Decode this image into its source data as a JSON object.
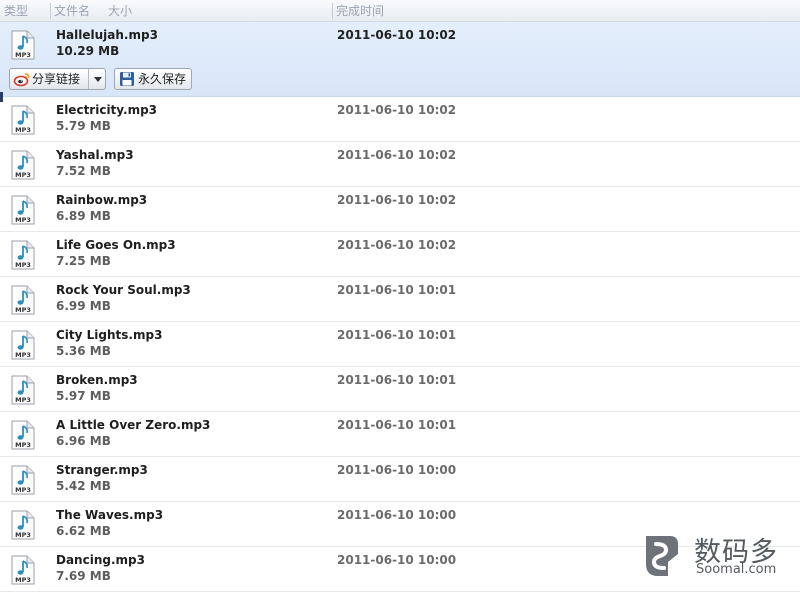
{
  "header": {
    "col_type": "类型",
    "col_name": "文件名",
    "col_size": "大小",
    "col_time": "完成时间"
  },
  "selected_actions": {
    "share_label": "分享链接",
    "save_label": "永久保存",
    "share_icon": "weibo-icon",
    "save_icon": "floppy-disk-icon"
  },
  "files": [
    {
      "name": "Hallelujah.mp3",
      "size": "10.29 MB",
      "time": "2011-06-10 10:02",
      "type_icon": "mp3-file-icon"
    },
    {
      "name": "Electricity.mp3",
      "size": "5.79 MB",
      "time": "2011-06-10 10:02",
      "type_icon": "mp3-file-icon"
    },
    {
      "name": "Yashal.mp3",
      "size": "7.52 MB",
      "time": "2011-06-10 10:02",
      "type_icon": "mp3-file-icon"
    },
    {
      "name": "Rainbow.mp3",
      "size": "6.89 MB",
      "time": "2011-06-10 10:02",
      "type_icon": "mp3-file-icon"
    },
    {
      "name": "Life Goes On.mp3",
      "size": "7.25 MB",
      "time": "2011-06-10 10:02",
      "type_icon": "mp3-file-icon"
    },
    {
      "name": "Rock Your Soul.mp3",
      "size": "6.99 MB",
      "time": "2011-06-10 10:01",
      "type_icon": "mp3-file-icon"
    },
    {
      "name": "City Lights.mp3",
      "size": "5.36 MB",
      "time": "2011-06-10 10:01",
      "type_icon": "mp3-file-icon"
    },
    {
      "name": "Broken.mp3",
      "size": "5.97 MB",
      "time": "2011-06-10 10:01",
      "type_icon": "mp3-file-icon"
    },
    {
      "name": "A Little Over Zero.mp3",
      "size": "6.96 MB",
      "time": "2011-06-10 10:01",
      "type_icon": "mp3-file-icon"
    },
    {
      "name": "Stranger.mp3",
      "size": "5.42 MB",
      "time": "2011-06-10 10:00",
      "type_icon": "mp3-file-icon"
    },
    {
      "name": "The Waves.mp3",
      "size": "6.62 MB",
      "time": "2011-06-10 10:00",
      "type_icon": "mp3-file-icon"
    },
    {
      "name": "Dancing.mp3",
      "size": "7.69 MB",
      "time": "2011-06-10 10:00",
      "type_icon": "mp3-file-icon"
    }
  ],
  "icon_label": "MP3",
  "watermark": {
    "cn": "数码多",
    "en": "Soomal.com"
  },
  "colors": {
    "selected_row": "#dbe7f8",
    "header_text": "#9aa4b2",
    "note_color": "#2a8fbd"
  }
}
